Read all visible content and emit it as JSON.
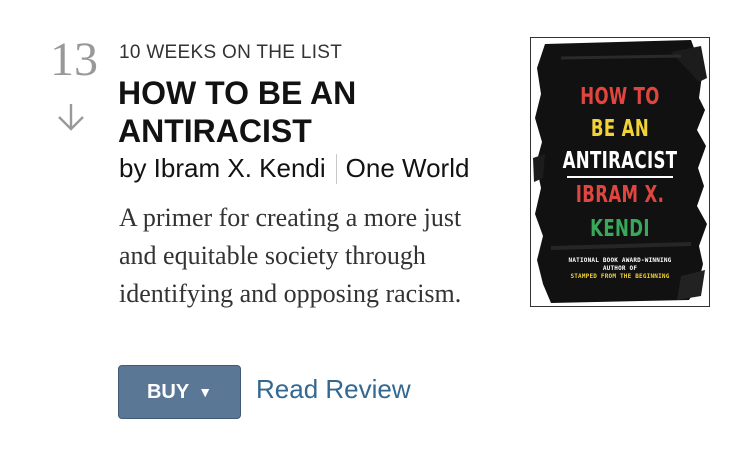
{
  "rank": {
    "number": "13",
    "trend_icon": "arrow-down-icon"
  },
  "book": {
    "weeks_on_list": "10 WEEKS ON THE LIST",
    "title": "HOW TO BE AN ANTIRACIST",
    "author": "by Ibram X. Kendi",
    "publisher": "One World",
    "description": "A primer for creating a more just and equitable society through identifying and opposing racism."
  },
  "actions": {
    "buy_label": "BUY",
    "buy_icon": "caret-down-icon",
    "review_label": "Read Review"
  },
  "cover": {
    "line1": "HOW TO",
    "line2": "BE AN",
    "line3": "ANTIRACIST",
    "line4": "IBRAM X.",
    "line5": "KENDI",
    "small1": "NATIONAL BOOK AWARD-WINNING",
    "small2": "AUTHOR OF",
    "small3": "STAMPED FROM THE BEGINNING"
  },
  "colors": {
    "buy_button": "#5a7896",
    "link": "#326891",
    "rank": "#999999",
    "cover_red": "#e0463f",
    "cover_yellow": "#f2d23a",
    "cover_green": "#3aa85a"
  }
}
